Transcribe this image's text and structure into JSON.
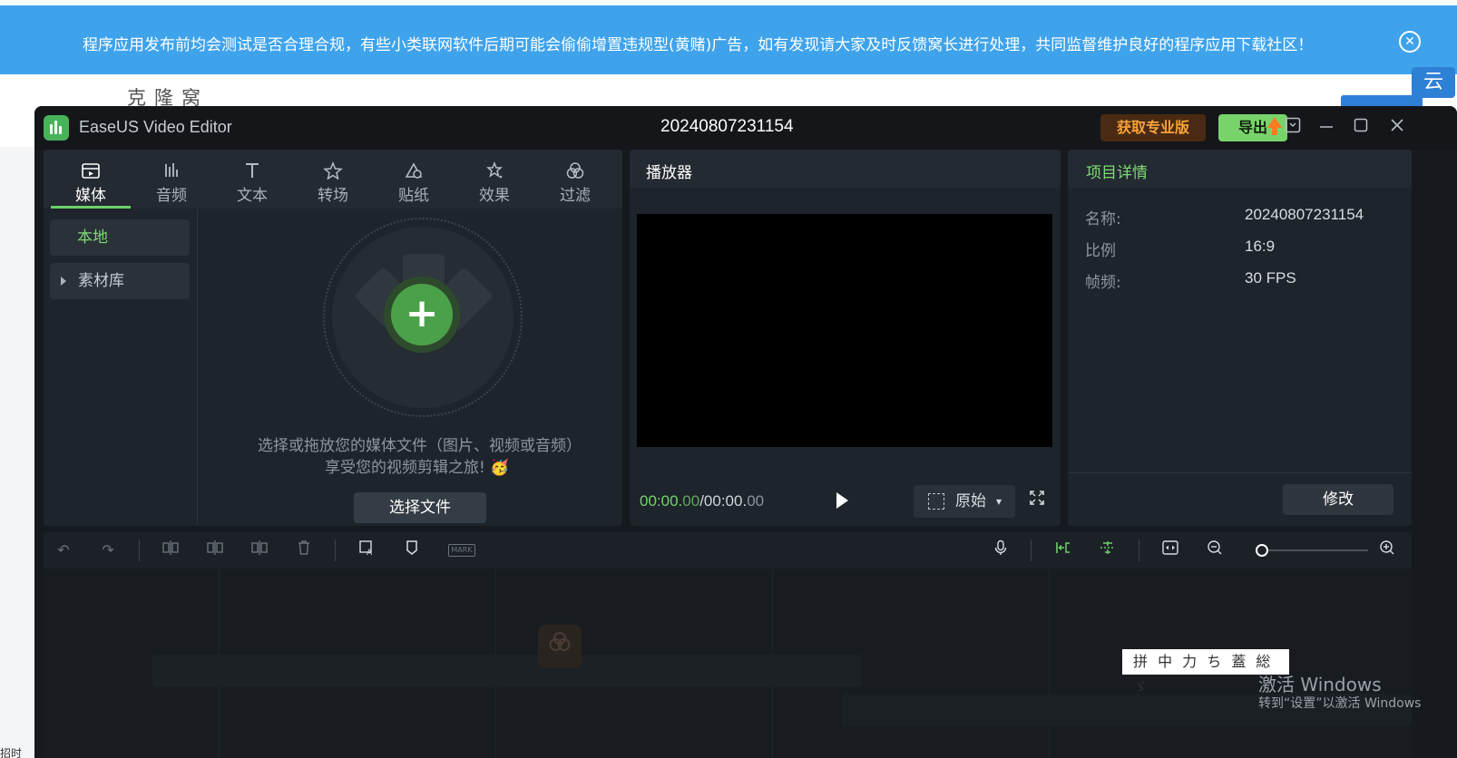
{
  "site": {
    "banner_text": "程序应用发布前均会测试是否合理合规，有些小类联网软件后期可能会偷偷增置违规型(黄赌)广告，如有发现请大家及时反馈窝长进行处理，共同监督维护良好的程序应用下载社区！",
    "logo_text": "克隆窝",
    "cloud_label": "云",
    "left_bottom_text": "招时"
  },
  "app": {
    "name": "EaseUS Video Editor",
    "project_title": "20240807231154",
    "pro_button": "获取专业版",
    "export_button": "导出",
    "colors": {
      "accent": "#6ccf6a",
      "pro": "#f7a23a",
      "export_bg": "#78d36b"
    }
  },
  "media_panel": {
    "tabs": [
      {
        "label": "媒体",
        "icon": "media-icon",
        "active": true
      },
      {
        "label": "音频",
        "icon": "audio-icon",
        "active": false
      },
      {
        "label": "文本",
        "icon": "text-icon",
        "active": false
      },
      {
        "label": "转场",
        "icon": "transition-icon",
        "active": false
      },
      {
        "label": "贴纸",
        "icon": "sticker-icon",
        "active": false
      },
      {
        "label": "效果",
        "icon": "effect-icon",
        "active": false
      },
      {
        "label": "过滤",
        "icon": "filter-icon",
        "active": false
      }
    ],
    "nav": {
      "local": "本地",
      "library": "素材库"
    },
    "drop_text_line1": "选择或拖放您的媒体文件（图片、视频或音频）",
    "drop_text_line2": "享受您的视频剪辑之旅!",
    "emoji": "🥳",
    "select_button": "选择文件"
  },
  "player": {
    "title": "播放器",
    "time_current_main": "00:00.",
    "time_current_frac": "00",
    "time_sep": "/",
    "time_total_main": "00:00.",
    "time_total_frac": "00",
    "ratio_label": "原始"
  },
  "details": {
    "title": "项目详情",
    "name_label": "名称:",
    "name_value": "20240807231154",
    "ratio_label": "比例",
    "ratio_value": "16:9",
    "fps_label": "帧频:",
    "fps_value": "30 FPS",
    "modify_button": "修改"
  },
  "toolbar": {
    "icons": [
      "undo-icon",
      "redo-icon",
      "split-icon",
      "split-left-icon",
      "split-right-icon",
      "delete-icon",
      "speech-to-text-icon",
      "marker-icon",
      "mark-icon",
      "microphone-icon",
      "snap-icon",
      "magnet-icon",
      "fit-icon",
      "zoom-out-icon",
      "zoom-in-icon"
    ],
    "mark_label": "MARK"
  },
  "ime": {
    "text": "拼 中 力 ち 蓋 総 ゞ"
  },
  "watermark": {
    "line1": "激活 Windows",
    "line2": "转到“设置”以激活 Windows"
  }
}
